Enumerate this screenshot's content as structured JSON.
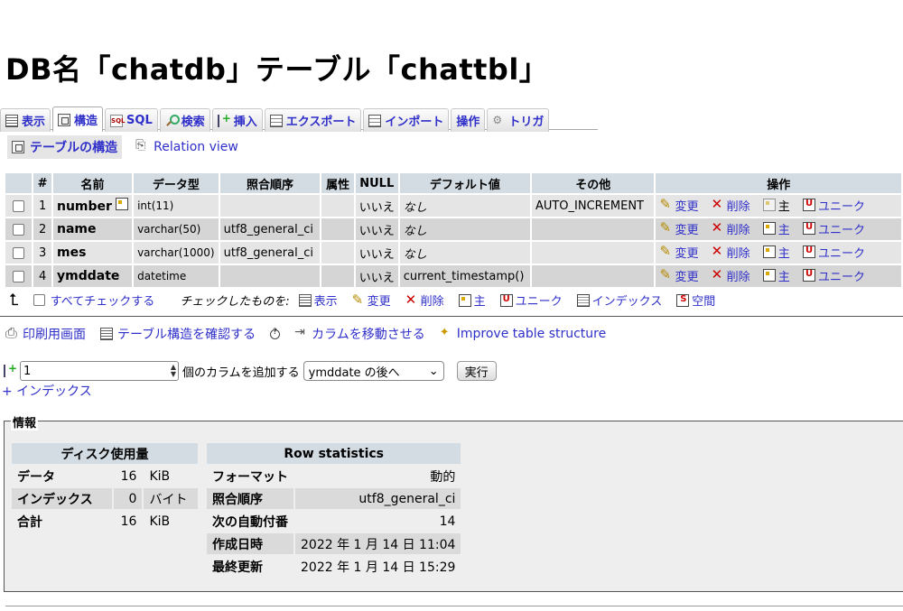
{
  "title": "DB名「chatdb」テーブル「chattbl」",
  "tabs": [
    {
      "label": "表示",
      "icon": "browse-icon"
    },
    {
      "label": "構造",
      "icon": "structure-icon"
    },
    {
      "label": "SQL",
      "icon": "sql-icon"
    },
    {
      "label": "検索",
      "icon": "search-icon"
    },
    {
      "label": "挿入",
      "icon": "insert-icon"
    },
    {
      "label": "エクスポート",
      "icon": "export-icon"
    },
    {
      "label": "インポート",
      "icon": "import-icon"
    },
    {
      "label": "操作",
      "icon": "operations-icon"
    },
    {
      "label": "トリガ",
      "icon": "triggers-icon"
    }
  ],
  "subnav": {
    "structure": "テーブルの構造",
    "relation": "Relation view"
  },
  "columns_header": [
    "#",
    "名前",
    "データ型",
    "照合順序",
    "属性",
    "NULL",
    "デフォルト値",
    "その他",
    "操作"
  ],
  "rows": [
    {
      "num": "1",
      "name": "number",
      "type": "int(11)",
      "collation": "",
      "attributes": "",
      "null": "いいえ",
      "default": "なし",
      "extra": "AUTO_INCREMENT"
    },
    {
      "num": "2",
      "name": "name",
      "type": "varchar(50)",
      "collation": "utf8_general_ci",
      "attributes": "",
      "null": "いいえ",
      "default": "なし",
      "extra": ""
    },
    {
      "num": "3",
      "name": "mes",
      "type": "varchar(1000)",
      "collation": "utf8_general_ci",
      "attributes": "",
      "null": "いいえ",
      "default": "なし",
      "extra": ""
    },
    {
      "num": "4",
      "name": "ymddate",
      "type": "datetime",
      "collation": "",
      "attributes": "",
      "null": "いいえ",
      "default": "current_timestamp()",
      "extra": ""
    }
  ],
  "row_actions": {
    "change": "変更",
    "drop": "削除",
    "primary": "主",
    "unique": "ユニーク"
  },
  "bulk": {
    "check_all": "すべてチェックする",
    "with_selected": "チェックしたものを:",
    "browse": "表示",
    "change": "変更",
    "drop": "削除",
    "primary": "主",
    "unique": "ユニーク",
    "index": "インデックス",
    "spatial": "空間"
  },
  "tools": {
    "print": "印刷用画面",
    "propose": "テーブル構造を確認する",
    "move": "カラムを移動させる",
    "improve": "Improve table structure"
  },
  "add_column": {
    "count": "1",
    "label": "個のカラムを追加する",
    "position": "ymddate の後へ",
    "go": "実行"
  },
  "add_index": "+ インデックス",
  "info": {
    "legend": "情報",
    "disk_usage": {
      "header": "ディスク使用量",
      "rows": [
        {
          "label": "データ",
          "value": "16",
          "unit": "KiB"
        },
        {
          "label": "インデックス",
          "value": "0",
          "unit": "バイト"
        },
        {
          "label": "合計",
          "value": "16",
          "unit": "KiB"
        }
      ]
    },
    "row_stats": {
      "header": "Row statistics",
      "rows": [
        {
          "label": "フォーマット",
          "value": "動的"
        },
        {
          "label": "照合順序",
          "value": "utf8_general_ci"
        },
        {
          "label": "次の自動付番",
          "value": "14"
        },
        {
          "label": "作成日時",
          "value": "2022 年 1 月 14 日 11:04"
        },
        {
          "label": "最終更新",
          "value": "2022 年 1 月 14 日 15:29"
        }
      ]
    }
  }
}
